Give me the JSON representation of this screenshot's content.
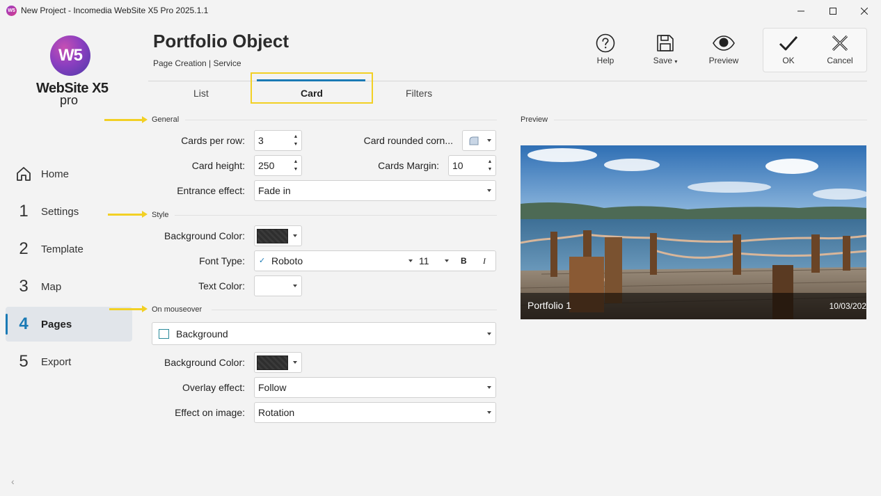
{
  "window": {
    "icon_text": "W5",
    "title": "New Project - Incomedia WebSite X5 Pro 2025.1.1"
  },
  "logo": {
    "mark": "W5",
    "name": "WebSite X5",
    "edition": "pro"
  },
  "sidebar": {
    "items": [
      {
        "num": "",
        "icon": "home-icon",
        "label": "Home"
      },
      {
        "num": "1",
        "label": "Settings"
      },
      {
        "num": "2",
        "label": "Template"
      },
      {
        "num": "3",
        "label": "Map"
      },
      {
        "num": "4",
        "label": "Pages",
        "active": true
      },
      {
        "num": "5",
        "label": "Export"
      }
    ],
    "collapse_glyph": "‹"
  },
  "header": {
    "title": "Portfolio Object",
    "breadcrumb": "Page Creation | Service"
  },
  "toolbar": {
    "help": "Help",
    "save": "Save",
    "preview": "Preview",
    "ok": "OK",
    "cancel": "Cancel"
  },
  "tabs": {
    "list": "List",
    "card": "Card",
    "filters": "Filters",
    "active": "Card"
  },
  "general": {
    "heading": "General",
    "cards_per_row_label": "Cards per row:",
    "cards_per_row": "3",
    "card_height_label": "Card height:",
    "card_height": "250",
    "entrance_effect_label": "Entrance effect:",
    "entrance_effect": "Fade in",
    "rounded_corners_label": "Card rounded corn...",
    "cards_margin_label": "Cards Margin:",
    "cards_margin": "10"
  },
  "style": {
    "heading": "Style",
    "bg_color_label": "Background Color:",
    "font_type_label": "Font Type:",
    "font_name": "Roboto",
    "font_size": "11",
    "bold": "B",
    "italic": "I",
    "text_color_label": "Text Color:"
  },
  "mouseover": {
    "heading": "On mouseover",
    "background_option": "Background",
    "bg_color_label": "Background Color:",
    "overlay_effect_label": "Overlay effect:",
    "overlay_effect": "Follow",
    "effect_on_image_label": "Effect on image:",
    "effect_on_image": "Rotation"
  },
  "preview": {
    "heading": "Preview",
    "caption_title": "Portfolio 1",
    "caption_date": "10/03/202"
  },
  "colors": {
    "accent": "#1a7ab5",
    "highlight": "#f2d024",
    "swatch_dark": "#333333"
  }
}
